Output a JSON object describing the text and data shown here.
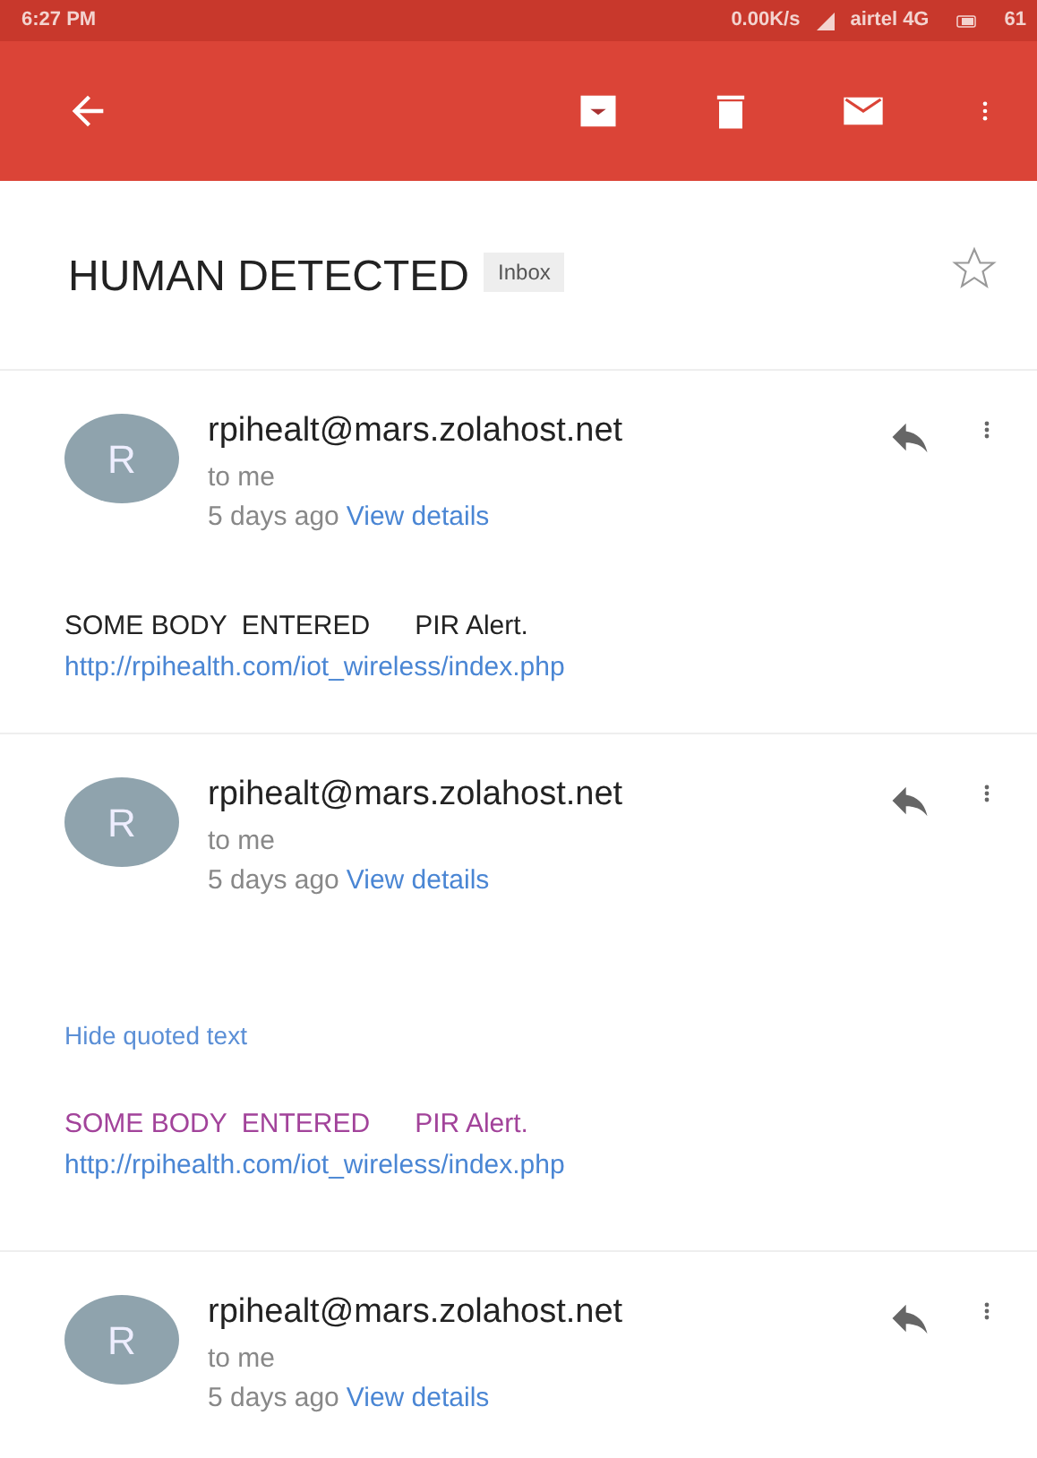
{
  "status_bar": {
    "time": "6:27 PM",
    "speed": "0.00K/s",
    "carrier": "airtel 4G",
    "battery": "61"
  },
  "subject": {
    "title": "HUMAN DETECTED",
    "label": "Inbox",
    "starred": false
  },
  "messages": [
    {
      "avatar": "R",
      "sender": "rpihealt@mars.zolahost.net",
      "recipient": "to me",
      "time": "5 days ago",
      "details_link": "View details",
      "body": {
        "kind": "plain",
        "text": "SOME BODY  ENTERED      PIR Alert.",
        "link": "http://rpihealth.com/iot_wireless/index.php"
      }
    },
    {
      "avatar": "R",
      "sender": "rpihealt@mars.zolahost.net",
      "recipient": "to me",
      "time": "5 days ago",
      "details_link": "View details",
      "quote_toggle": "Hide quoted text",
      "body": {
        "kind": "quoted",
        "text": "SOME BODY  ENTERED      PIR Alert.",
        "link": "http://rpihealth.com/iot_wireless/index.php"
      }
    },
    {
      "avatar": "R",
      "sender": "rpihealt@mars.zolahost.net",
      "recipient": "to me",
      "time": "5 days ago",
      "details_link": "View details"
    }
  ]
}
